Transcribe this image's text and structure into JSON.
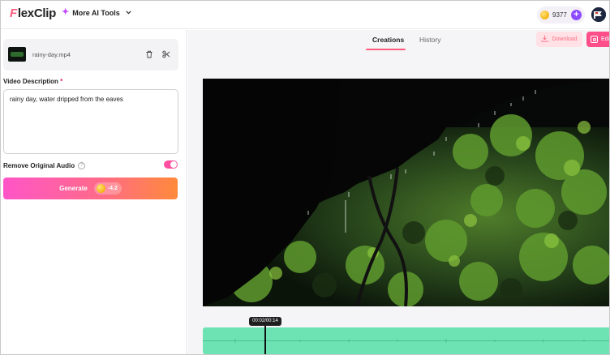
{
  "header": {
    "logo_prefix": "F",
    "logo_rest": "lexClip",
    "more_tools_label": "More AI Tools",
    "credits_value": "9377"
  },
  "left_panel": {
    "file_name": "rainy-day.mp4",
    "video_description_label": "Video Description",
    "required_mark": "*",
    "video_description_value": "rainy day, water dripped from the eaves",
    "remove_audio_label": "Remove Original Audio",
    "remove_audio_enabled": true,
    "generate_label": "Generate",
    "generate_cost": "-4.2"
  },
  "right_panel": {
    "tabs": [
      {
        "label": "Creations",
        "active": true
      },
      {
        "label": "History",
        "active": false
      }
    ],
    "download_label": "Download",
    "edit_label": "Edi",
    "playhead_time": "00:02/00:14"
  },
  "colors": {
    "accent_pink": "#ff4fa0",
    "generate_gradient": [
      "#ff55c8",
      "#ff8a3a"
    ],
    "waveform": "#6de3b4",
    "credits_plus": "#8d4bff"
  },
  "icons": [
    "sparkle-icon",
    "chevron-down-icon",
    "coin-icon",
    "plus-icon",
    "trash-icon",
    "scissors-icon",
    "help-icon",
    "download-icon",
    "edit-icon"
  ]
}
